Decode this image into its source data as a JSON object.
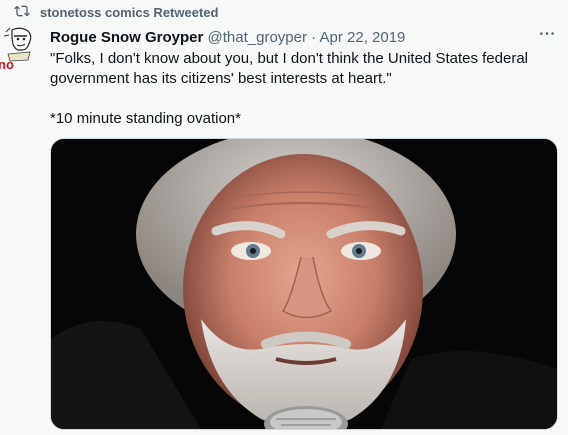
{
  "retweet": {
    "icon": "retweet-icon",
    "label": "stonetoss comics Retweeted"
  },
  "tweet": {
    "author_name": "Rogue Snow Groyper",
    "handle": "@that_groyper",
    "separator": "·",
    "date": "Apr 22, 2019",
    "text": "\"Folks, I don't know about you, but I don't think the United States federal government has its citizens' best interests at heart.\"\n\n*10 minute standing ovation*",
    "avatar_text": "no",
    "more_icon": "more-horizontal-icon"
  },
  "colors": {
    "secondary_text": "#536471",
    "primary_text": "#0f1419",
    "background": "#f7f9f9"
  }
}
